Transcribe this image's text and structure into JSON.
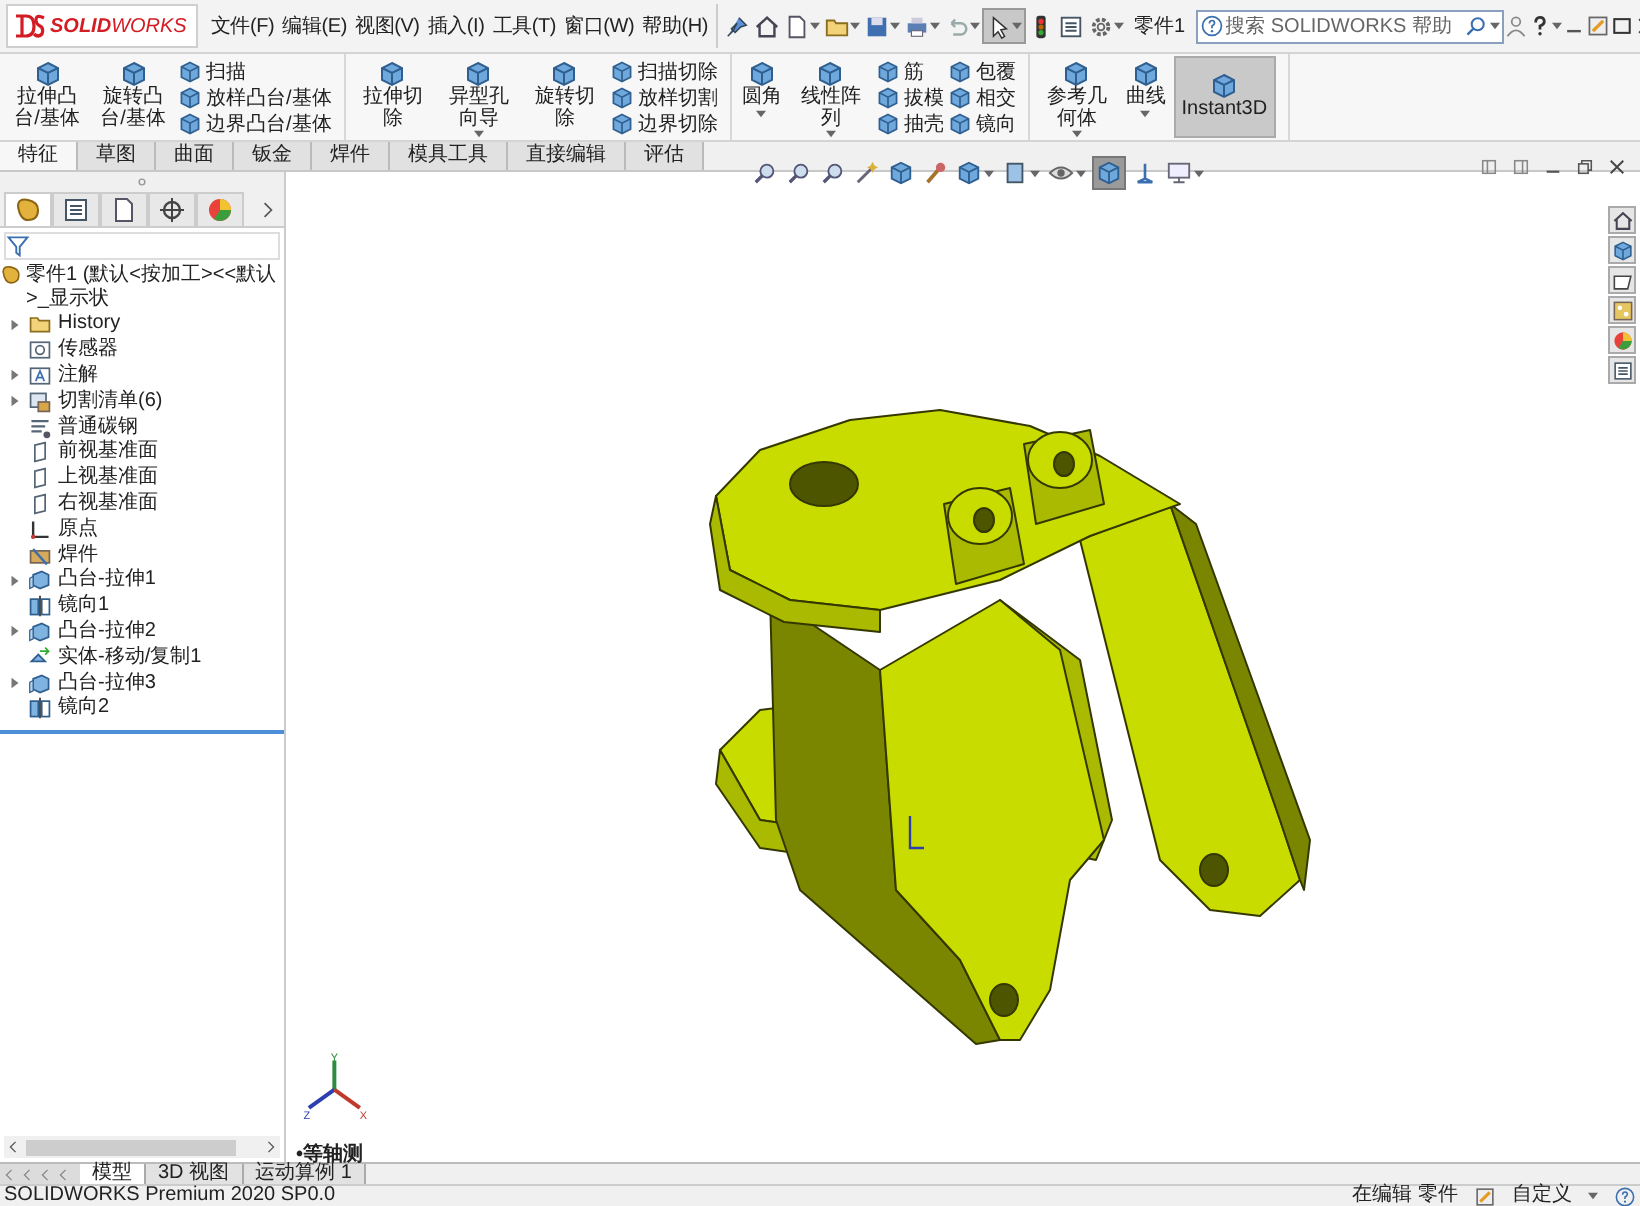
{
  "logo": {
    "text": "**SOLID**WORKS"
  },
  "menu": [
    {
      "label": "文件(F)"
    },
    {
      "label": "编辑(E)"
    },
    {
      "label": "视图(V)"
    },
    {
      "label": "插入(I)"
    },
    {
      "label": "工具(T)"
    },
    {
      "label": "窗口(W)"
    },
    {
      "label": "帮助(H)"
    }
  ],
  "quick_access": [
    {
      "kind": "pin",
      "dropdown": false,
      "selected": false
    },
    {
      "kind": "house",
      "dropdown": false,
      "selected": false
    },
    {
      "kind": "page",
      "dropdown": true,
      "selected": false
    },
    {
      "kind": "folder",
      "dropdown": true,
      "selected": false
    },
    {
      "kind": "floppy",
      "dropdown": true,
      "selected": false
    },
    {
      "kind": "printer",
      "dropdown": true,
      "selected": false
    },
    {
      "kind": "undo",
      "dropdown": true,
      "selected": false
    },
    {
      "kind": "cursor",
      "dropdown": true,
      "selected": true
    },
    {
      "kind": "traffic-light",
      "dropdown": false,
      "selected": false
    },
    {
      "kind": "list",
      "dropdown": false,
      "selected": false
    },
    {
      "kind": "gear",
      "dropdown": true,
      "selected": false
    }
  ],
  "document_name": "零件1",
  "search": {
    "placeholder": "搜索 SOLIDWORKS 帮助"
  },
  "ribbon": [
    {
      "items": [
        {
          "kind": "large",
          "label": "拉伸凸台/基体",
          "dropdown": false,
          "selected": false
        },
        {
          "kind": "large",
          "label": "旋转凸台/基体",
          "dropdown": false,
          "selected": false
        },
        {
          "kind": "stack",
          "entries": [
            {
              "label": "扫描"
            },
            {
              "label": "放样凸台/基体"
            },
            {
              "label": "边界凸台/基体"
            }
          ]
        }
      ]
    },
    {
      "items": [
        {
          "kind": "large",
          "label": "拉伸切除",
          "dropdown": false,
          "selected": false
        },
        {
          "kind": "large",
          "label": "异型孔向导",
          "dropdown": true,
          "selected": false
        },
        {
          "kind": "large",
          "label": "旋转切除",
          "dropdown": false,
          "selected": false
        },
        {
          "kind": "stack",
          "entries": [
            {
              "label": "扫描切除"
            },
            {
              "label": "放样切割"
            },
            {
              "label": "边界切除"
            }
          ]
        }
      ]
    },
    {
      "items": [
        {
          "kind": "large",
          "label": "圆角",
          "dropdown": true,
          "selected": false
        },
        {
          "kind": "large",
          "label": "线性阵列",
          "dropdown": true,
          "selected": false
        },
        {
          "kind": "stack",
          "entries": [
            {
              "label": "筋"
            },
            {
              "label": "拔模"
            },
            {
              "label": "抽壳"
            }
          ]
        },
        {
          "kind": "stack",
          "entries": [
            {
              "label": "包覆"
            },
            {
              "label": "相交"
            },
            {
              "label": "镜向"
            }
          ]
        }
      ]
    },
    {
      "items": [
        {
          "kind": "large",
          "label": "参考几何体",
          "dropdown": true,
          "selected": false
        },
        {
          "kind": "large",
          "label": "曲线",
          "dropdown": true,
          "selected": false
        },
        {
          "kind": "large",
          "label": "Instant3D",
          "dropdown": false,
          "selected": true
        }
      ]
    }
  ],
  "command_tabs": [
    {
      "label": "特征",
      "selected": true
    },
    {
      "label": "草图",
      "selected": false
    },
    {
      "label": "曲面",
      "selected": false
    },
    {
      "label": "钣金",
      "selected": false
    },
    {
      "label": "焊件",
      "selected": false
    },
    {
      "label": "模具工具",
      "selected": false
    },
    {
      "label": "直接编辑",
      "selected": false
    },
    {
      "label": "评估",
      "selected": false
    }
  ],
  "view_toolbar": [
    {
      "kind": "magnifier",
      "dropdown": false,
      "selected": false
    },
    {
      "kind": "magnifier",
      "dropdown": false,
      "selected": false
    },
    {
      "kind": "magnifier",
      "dropdown": false,
      "selected": false
    },
    {
      "kind": "wand",
      "dropdown": false,
      "selected": false
    },
    {
      "kind": "cube",
      "dropdown": false,
      "selected": false
    },
    {
      "kind": "brush",
      "dropdown": false,
      "selected": false
    },
    {
      "kind": "cube",
      "dropdown": true,
      "selected": false
    },
    {
      "kind": "box",
      "dropdown": true,
      "selected": false
    },
    {
      "kind": "eye",
      "dropdown": true,
      "selected": false
    },
    {
      "kind": "cube",
      "dropdown": false,
      "selected": true
    },
    {
      "kind": "axes",
      "dropdown": false,
      "selected": false
    },
    {
      "kind": "monitor",
      "dropdown": true,
      "selected": false
    }
  ],
  "panel_tabs": [
    {
      "kind": "part",
      "selected": true
    },
    {
      "kind": "list",
      "selected": false
    },
    {
      "kind": "page",
      "selected": false
    },
    {
      "kind": "crosshair",
      "selected": false
    },
    {
      "kind": "ball",
      "selected": false
    }
  ],
  "tree": {
    "root": "零件1  (默认<按加工><<默认>_显示状",
    "items": [
      {
        "label": "History",
        "kind": "folder",
        "expandable": true,
        "expanded": false
      },
      {
        "label": "传感器",
        "kind": "sensor",
        "expandable": false
      },
      {
        "label": "注解",
        "kind": "annotation",
        "expandable": true,
        "expanded": false
      },
      {
        "label": "切割清单(6)",
        "kind": "cutlist",
        "expandable": true,
        "expanded": false
      },
      {
        "label": "普通碳钢",
        "kind": "material",
        "expandable": false
      },
      {
        "label": "前视基准面",
        "kind": "plane",
        "expandable": false
      },
      {
        "label": "上视基准面",
        "kind": "plane",
        "expandable": false
      },
      {
        "label": "右视基准面",
        "kind": "plane",
        "expandable": false
      },
      {
        "label": "原点",
        "kind": "origin",
        "expandable": false
      },
      {
        "label": "焊件",
        "kind": "weldment",
        "expandable": false
      },
      {
        "label": "凸台-拉伸1",
        "kind": "extrude",
        "expandable": true,
        "expanded": false
      },
      {
        "label": "镜向1",
        "kind": "mirror",
        "expandable": false
      },
      {
        "label": "凸台-拉伸2",
        "kind": "extrude",
        "expandable": true,
        "expanded": false
      },
      {
        "label": "实体-移动/复制1",
        "kind": "move",
        "expandable": false
      },
      {
        "label": "凸台-拉伸3",
        "kind": "extrude",
        "expandable": true,
        "expanded": false
      },
      {
        "label": "镜向2",
        "kind": "mirror",
        "expandable": false
      }
    ]
  },
  "triad": {
    "labels": [
      {
        "kind": "y",
        "text": "Y"
      },
      {
        "kind": "z",
        "text": "Z"
      },
      {
        "kind": "x",
        "text": "X"
      }
    ]
  },
  "view_label": "•等轴测",
  "bottom_tabs": [
    {
      "label": "模型",
      "selected": true
    },
    {
      "label": "3D 视图",
      "selected": false
    },
    {
      "label": "运动算例 1",
      "selected": false
    }
  ],
  "status_bar": {
    "product": "SOLIDWORKS Premium 2020 SP0.0",
    "mode": "在编辑 零件",
    "units": "自定义"
  }
}
